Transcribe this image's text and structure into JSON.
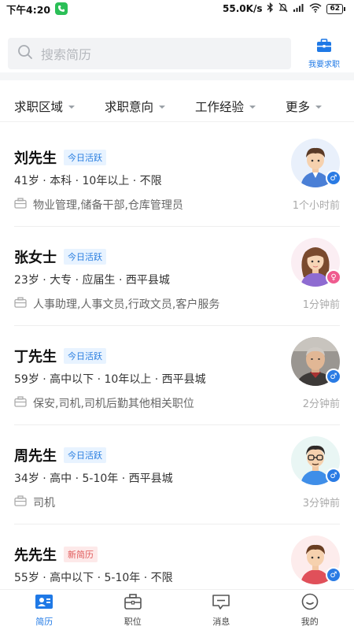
{
  "status_bar": {
    "time": "下午4:20",
    "net_speed": "55.0K/s",
    "battery": "62"
  },
  "search": {
    "placeholder": "搜索简历",
    "job_seek_label": "我要求职"
  },
  "filters": [
    "求职区域",
    "工作经验",
    "求职意向",
    "更多"
  ],
  "filter_order": [
    "求职区域",
    "求职意向",
    "工作经验",
    "更多"
  ],
  "candidates": [
    {
      "name": "刘先生",
      "tag": "今日活跃",
      "tag_type": "active",
      "meta": "41岁 · 本科 · 10年以上 · 不限",
      "expect": "物业管理,储备干部,仓库管理员",
      "time": "1个小时前",
      "gender": "male"
    },
    {
      "name": "张女士",
      "tag": "今日活跃",
      "tag_type": "active",
      "meta": "23岁 · 大专 · 应届生 · 西平县城",
      "expect": "人事助理,人事文员,行政文员,客户服务",
      "time": "1分钟前",
      "gender": "female"
    },
    {
      "name": "丁先生",
      "tag": "今日活跃",
      "tag_type": "active",
      "meta": "59岁 · 高中以下 · 10年以上 · 西平县城",
      "expect": "保安,司机,司机后勤其他相关职位",
      "time": "2分钟前",
      "gender": "male"
    },
    {
      "name": "周先生",
      "tag": "今日活跃",
      "tag_type": "active",
      "meta": "34岁 · 高中 · 5-10年 · 西平县城",
      "expect": "司机",
      "time": "3分钟前",
      "gender": "male"
    },
    {
      "name": "先先生",
      "tag": "新简历",
      "tag_type": "new",
      "meta": "55岁 · 高中以下 · 5-10年 · 不限",
      "expect": "",
      "time": "",
      "gender": "male"
    }
  ],
  "tabs": [
    {
      "label": "简历",
      "icon": "resume-icon",
      "active": true
    },
    {
      "label": "职位",
      "icon": "briefcase-icon",
      "active": false
    },
    {
      "label": "消息",
      "icon": "message-icon",
      "active": false
    },
    {
      "label": "我的",
      "icon": "profile-icon",
      "active": false
    }
  ],
  "colors": {
    "accent": "#1f79e6",
    "active_tag_bg": "#e8f3ff",
    "new_tag_bg": "#fde9e9",
    "female": "#ef5b8f"
  }
}
